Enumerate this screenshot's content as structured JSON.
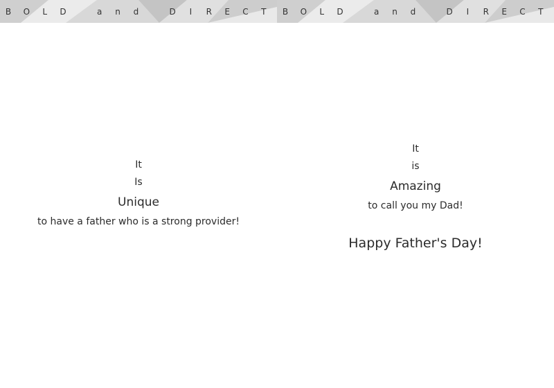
{
  "left_page": {
    "banner": [
      "B",
      "O",
      "L",
      "D",
      "",
      "a",
      "n",
      "d",
      "",
      "D",
      "I",
      "R",
      "E",
      "C",
      "T"
    ],
    "line1": "It",
    "line2": "Is",
    "line3": "Unique",
    "line4": "to have a father who is a strong provider!"
  },
  "right_page": {
    "banner": [
      "B",
      "O",
      "L",
      "D",
      "",
      "a",
      "n",
      "d",
      "",
      "D",
      "I",
      "R",
      "E",
      "C",
      "T"
    ],
    "line1": "It",
    "line2": "is",
    "line3": "Amazing",
    "line4": "to call you my Dad!",
    "greeting": "Happy Father's Day!"
  },
  "colors": {
    "banner_light": "#e6e6e6",
    "banner_mid": "#d2d2d2",
    "banner_dark": "#bdbdbd",
    "text": "#2b2b2b"
  }
}
